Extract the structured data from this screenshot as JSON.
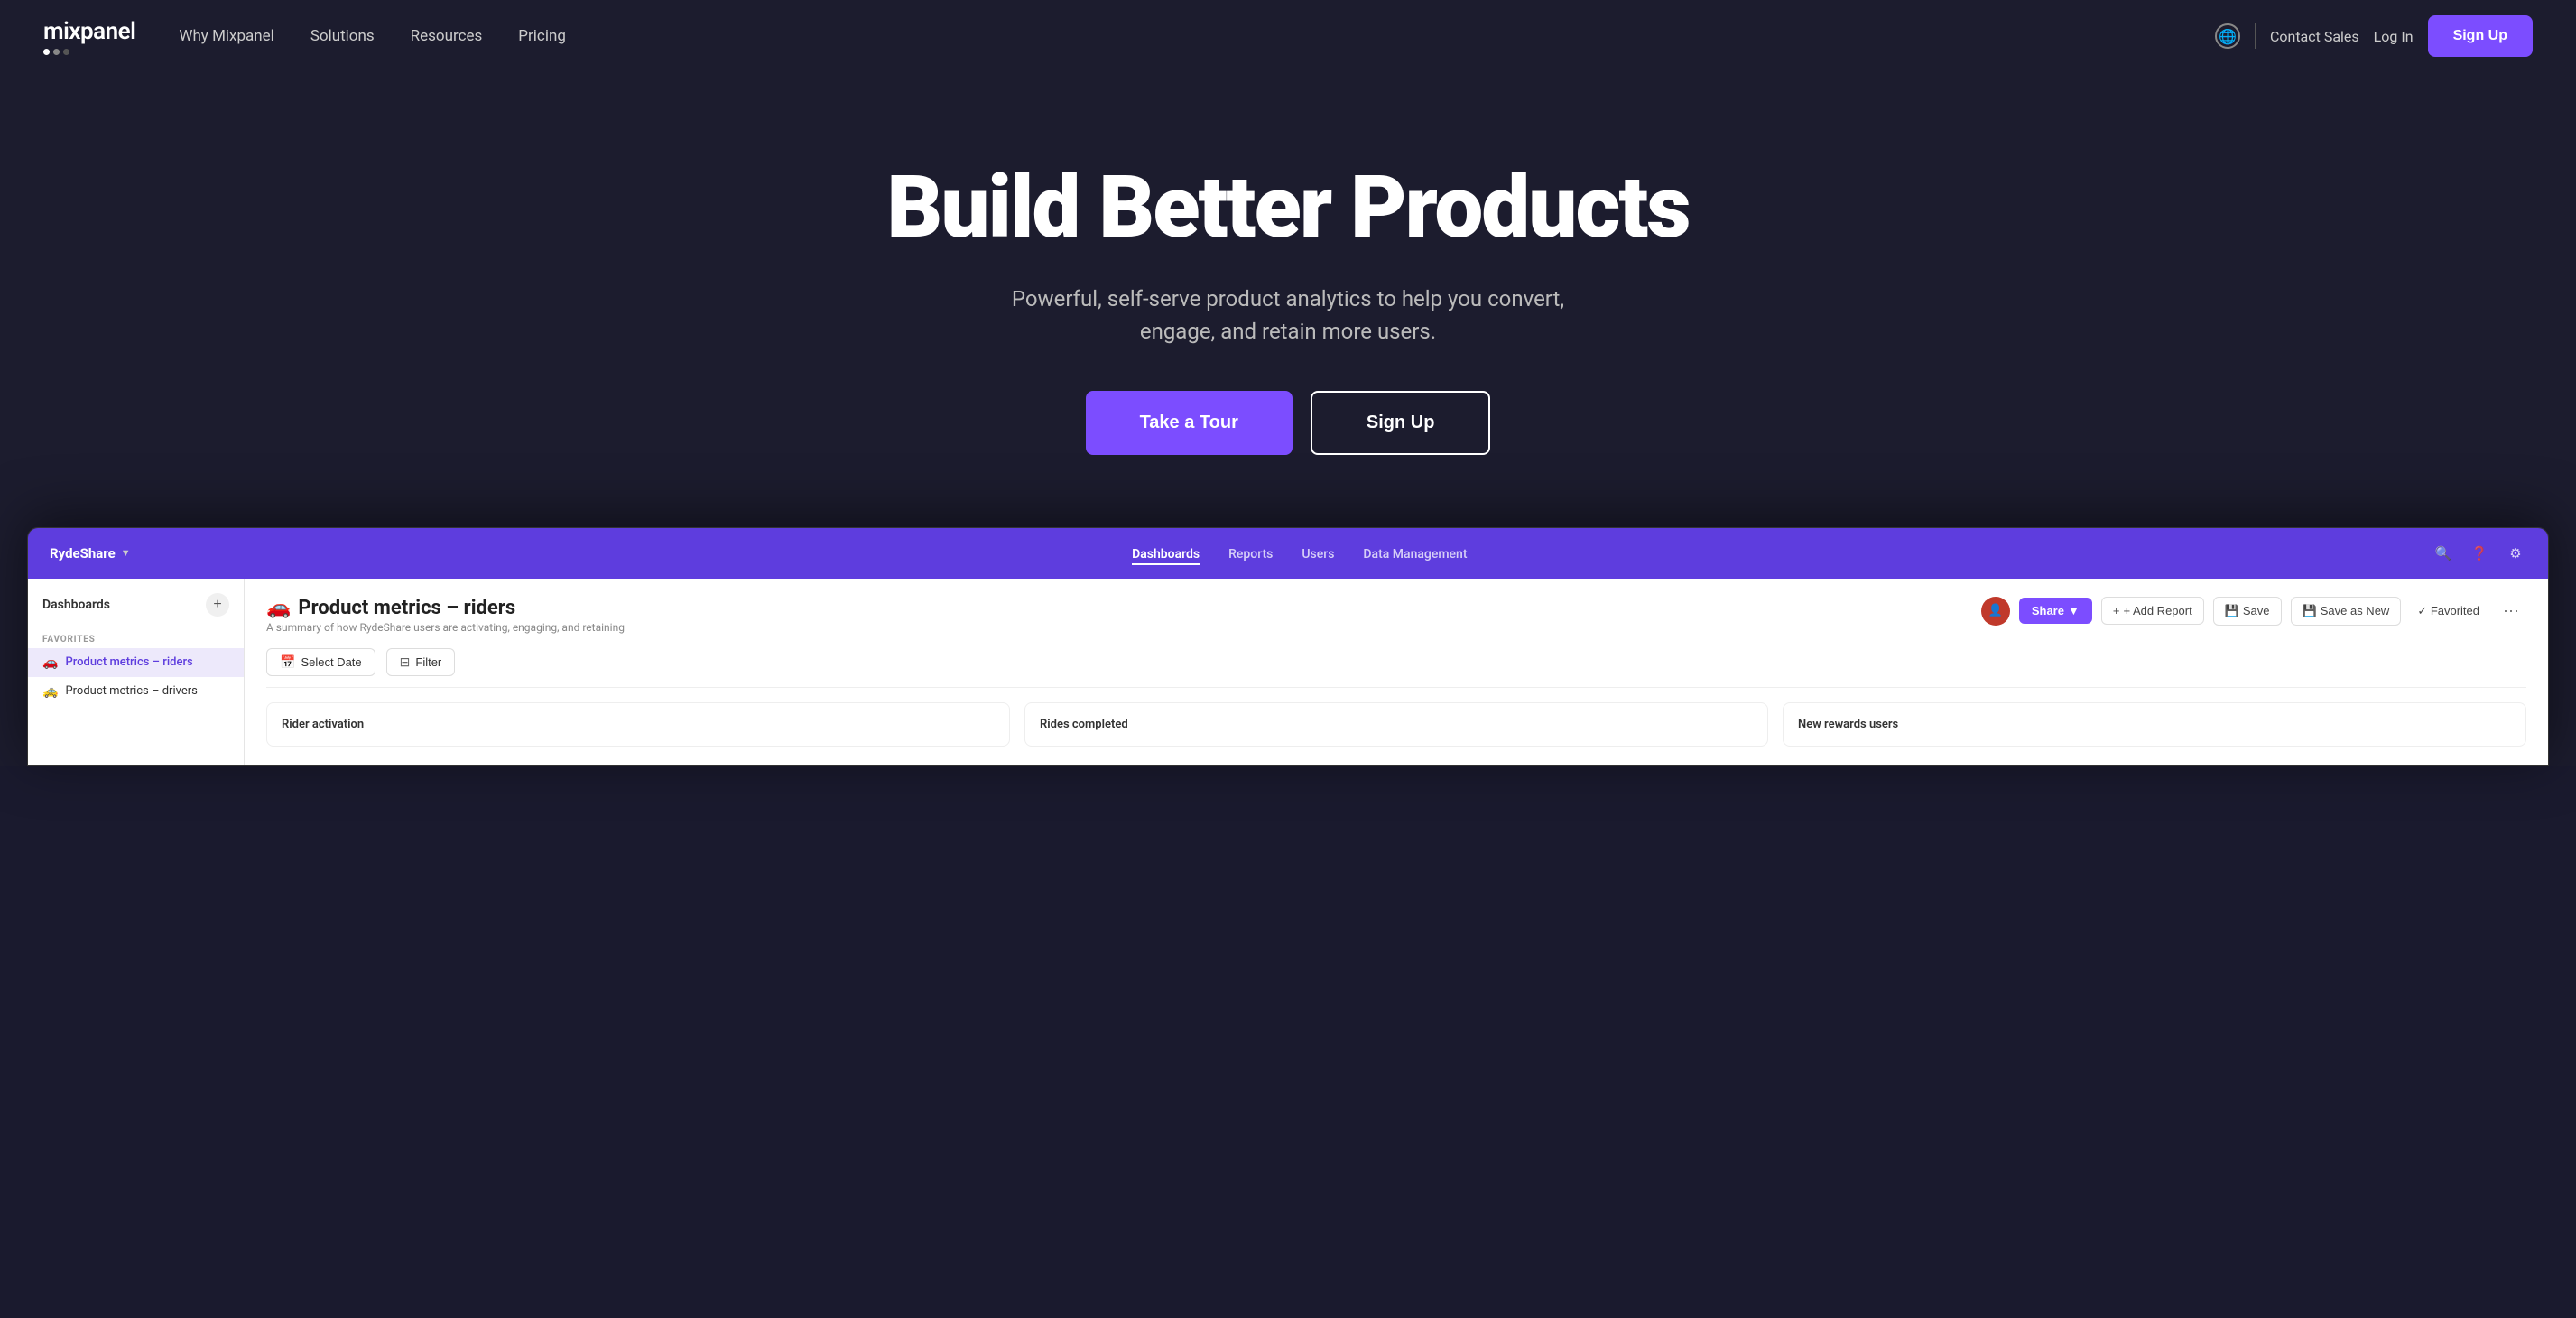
{
  "nav": {
    "logo_text": "mixpanel",
    "links": [
      {
        "label": "Why Mixpanel",
        "href": "#"
      },
      {
        "label": "Solutions",
        "href": "#"
      },
      {
        "label": "Resources",
        "href": "#"
      },
      {
        "label": "Pricing",
        "href": "#"
      }
    ],
    "contact_label": "Contact Sales",
    "login_label": "Log In",
    "signup_label": "Sign Up"
  },
  "hero": {
    "title": "Build Better Products",
    "subtitle": "Powerful, self-serve product analytics to help you convert, engage, and retain more users.",
    "tour_button": "Take a Tour",
    "signup_button": "Sign Up"
  },
  "app": {
    "brand": "RydeShare",
    "nav_links": [
      {
        "label": "Dashboards",
        "active": true
      },
      {
        "label": "Reports",
        "active": false
      },
      {
        "label": "Users",
        "active": false
      },
      {
        "label": "Data Management",
        "active": false
      }
    ],
    "sidebar": {
      "title": "Dashboards",
      "section_label": "FAVORITES",
      "items": [
        {
          "label": "Product metrics – riders",
          "icon": "🚗",
          "active": true
        },
        {
          "label": "Product metrics – drivers",
          "icon": "🚕",
          "active": false
        }
      ]
    },
    "dashboard": {
      "title": "Product metrics – riders",
      "icon": "🚗",
      "description": "A summary of how RydeShare users are activating, engaging, and retaining",
      "share_label": "Share",
      "add_report_label": "+ Add Report",
      "save_label": "Save",
      "save_as_new_label": "Save as New",
      "favorited_label": "✓ Favorited",
      "select_date_label": "Select Date",
      "filter_label": "Filter",
      "metrics": [
        {
          "title": "Rider activation"
        },
        {
          "title": "Rides completed"
        },
        {
          "title": "New rewards users"
        }
      ]
    }
  }
}
